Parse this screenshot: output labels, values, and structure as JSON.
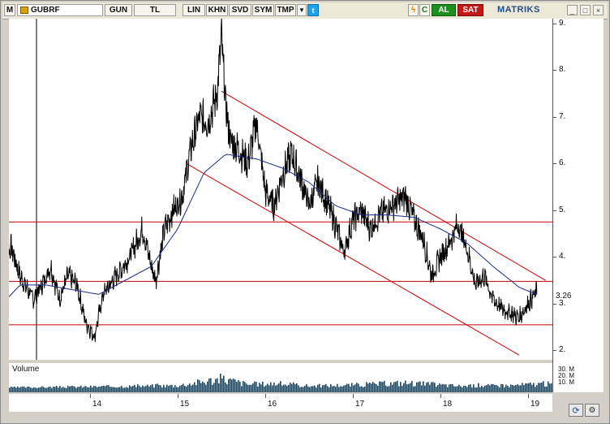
{
  "toolbar": {
    "m_label": "M",
    "symbol": "GUBRF",
    "period": "GUN",
    "currency": "TL",
    "scale": "LIN",
    "khn": "KHN",
    "svd": "SVD",
    "sym": "SYM",
    "tmp": "TMP",
    "c_label": "C",
    "buy": "AL",
    "sell": "SAT",
    "logo": "MATRIKS"
  },
  "window_buttons": [
    "_",
    "□",
    "×"
  ],
  "volume": {
    "label": "Volume",
    "axis_labels": [
      "30. M",
      "20. M",
      "10. M"
    ]
  },
  "price_label": "3.26",
  "colors": {
    "price": "#000000",
    "ma": "#1b2a8c",
    "trend": "#cc0000",
    "volume": "#12496e"
  },
  "chart_data": {
    "type": "line",
    "title": "",
    "yticks": [
      2,
      3,
      4,
      5,
      6,
      7,
      8,
      9
    ],
    "xticks": [
      "14",
      "15",
      "16",
      "17",
      "18",
      "19"
    ],
    "ylim": [
      1.8,
      9.1
    ],
    "last_price": 3.26,
    "horizontal_levels": [
      4.75,
      3.48,
      2.55
    ],
    "channel_upper": [
      [
        15.5,
        7.55
      ],
      [
        19.2,
        3.5
      ]
    ],
    "channel_lower": [
      [
        15.1,
        6.0
      ],
      [
        18.9,
        1.9
      ]
    ],
    "price_keypoints": [
      [
        13.0,
        4.1
      ],
      [
        13.1,
        4.2
      ],
      [
        13.2,
        3.6
      ],
      [
        13.35,
        3.1
      ],
      [
        13.45,
        3.4
      ],
      [
        13.55,
        3.8
      ],
      [
        13.65,
        3.1
      ],
      [
        13.75,
        3.6
      ],
      [
        13.85,
        3.4
      ],
      [
        13.95,
        2.6
      ],
      [
        14.05,
        2.3
      ],
      [
        14.15,
        3.2
      ],
      [
        14.3,
        3.6
      ],
      [
        14.45,
        4.0
      ],
      [
        14.6,
        4.6
      ],
      [
        14.7,
        3.8
      ],
      [
        14.75,
        3.5
      ],
      [
        14.85,
        4.6
      ],
      [
        14.95,
        5.0
      ],
      [
        15.05,
        5.3
      ],
      [
        15.15,
        6.3
      ],
      [
        15.25,
        7.0
      ],
      [
        15.35,
        6.9
      ],
      [
        15.45,
        7.5
      ],
      [
        15.5,
        8.7
      ],
      [
        15.55,
        7.2
      ],
      [
        15.6,
        6.5
      ],
      [
        15.7,
        6.3
      ],
      [
        15.8,
        6.0
      ],
      [
        15.9,
        6.9
      ],
      [
        16.0,
        5.4
      ],
      [
        16.1,
        5.1
      ],
      [
        16.2,
        5.8
      ],
      [
        16.3,
        6.2
      ],
      [
        16.4,
        5.7
      ],
      [
        16.5,
        5.1
      ],
      [
        16.6,
        5.6
      ],
      [
        16.7,
        5.2
      ],
      [
        16.8,
        4.7
      ],
      [
        16.9,
        4.1
      ],
      [
        17.0,
        4.8
      ],
      [
        17.1,
        5.0
      ],
      [
        17.2,
        4.6
      ],
      [
        17.3,
        4.9
      ],
      [
        17.45,
        5.1
      ],
      [
        17.6,
        5.3
      ],
      [
        17.7,
        4.8
      ],
      [
        17.8,
        4.4
      ],
      [
        17.9,
        3.6
      ],
      [
        18.0,
        4.0
      ],
      [
        18.1,
        4.3
      ],
      [
        18.2,
        4.7
      ],
      [
        18.3,
        4.2
      ],
      [
        18.4,
        3.4
      ],
      [
        18.5,
        3.6
      ],
      [
        18.6,
        3.1
      ],
      [
        18.7,
        2.9
      ],
      [
        18.8,
        2.8
      ],
      [
        18.9,
        2.7
      ],
      [
        19.0,
        3.0
      ],
      [
        19.1,
        3.26
      ]
    ],
    "ma_keypoints": [
      [
        13.0,
        3.0
      ],
      [
        13.2,
        3.4
      ],
      [
        13.5,
        3.4
      ],
      [
        13.8,
        3.3
      ],
      [
        14.1,
        3.2
      ],
      [
        14.4,
        3.5
      ],
      [
        14.7,
        3.8
      ],
      [
        15.0,
        4.6
      ],
      [
        15.3,
        5.8
      ],
      [
        15.55,
        6.2
      ],
      [
        15.9,
        6.1
      ],
      [
        16.2,
        5.9
      ],
      [
        16.5,
        5.6
      ],
      [
        16.8,
        5.1
      ],
      [
        17.1,
        4.9
      ],
      [
        17.4,
        4.9
      ],
      [
        17.7,
        4.85
      ],
      [
        18.0,
        4.6
      ],
      [
        18.3,
        4.3
      ],
      [
        18.6,
        3.8
      ],
      [
        18.9,
        3.35
      ],
      [
        19.1,
        3.2
      ]
    ],
    "volume_keypoints": [
      [
        13.0,
        0.15
      ],
      [
        13.6,
        0.2
      ],
      [
        14.2,
        0.25
      ],
      [
        15.0,
        0.35
      ],
      [
        15.5,
        1.0
      ],
      [
        15.8,
        0.45
      ],
      [
        16.1,
        0.55
      ],
      [
        16.5,
        0.3
      ],
      [
        17.0,
        0.4
      ],
      [
        17.6,
        0.6
      ],
      [
        18.2,
        0.3
      ],
      [
        18.8,
        0.35
      ],
      [
        19.1,
        0.5
      ]
    ]
  }
}
